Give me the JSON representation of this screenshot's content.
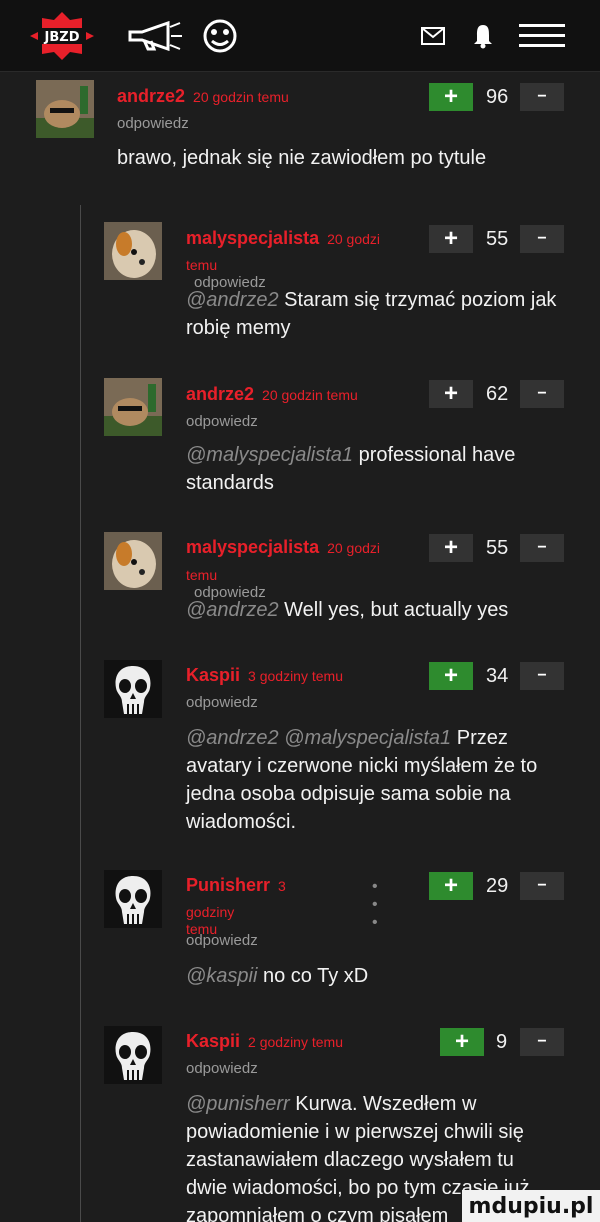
{
  "header": {
    "logo_text": "JBZD"
  },
  "comments": [
    {
      "author": "andrze2",
      "time": "20 godzin temu",
      "reply_label": "odpowiedz",
      "score": "96",
      "plus_label": "+",
      "minus_label": "−",
      "text": "brawo, jednak się nie zawiodłem po tytule"
    },
    {
      "author": "malyspecjalista",
      "time": "20 godzi",
      "time_cont": "temu",
      "reply_label": "odpowiedz",
      "score": "55",
      "plus_label": "+",
      "minus_label": "−",
      "mention": "@andrze2",
      "text_line1": "Staram się trzymać poziom jak",
      "text_line2": "robię memy"
    },
    {
      "author": "andrze2",
      "time": "20 godzin temu",
      "reply_label": "odpowiedz",
      "score": "62",
      "plus_label": "+",
      "minus_label": "−",
      "mention": "@malyspecjalista1",
      "text_line1": "professional have",
      "text_line2": "standards"
    },
    {
      "author": "malyspecjalista",
      "time": "20 godzi",
      "time_cont": "temu",
      "reply_label": "odpowiedz",
      "score": "55",
      "plus_label": "+",
      "minus_label": "−",
      "mention": "@andrze2",
      "text": "Well yes, but actually yes"
    },
    {
      "author": "Kaspii",
      "time": "3 godziny temu",
      "reply_label": "odpowiedz",
      "score": "34",
      "plus_label": "+",
      "minus_label": "−",
      "mention": "@andrze2 @malyspecjalista1",
      "text_line1": "Przez",
      "text_line2": "avatary i czerwone nicki myślałem że to",
      "text_line3": "jedna osoba odpisuje sama sobie na",
      "text_line4": "wiadomości."
    },
    {
      "author": "Punisherr",
      "time": "3",
      "time_cont": "godziny temu",
      "reply_label": "odpowiedz",
      "score": "29",
      "dots": "• • •",
      "plus_label": "+",
      "minus_label": "−",
      "mention": "@kaspii",
      "text": "no co Ty xD"
    },
    {
      "author": "Kaspii",
      "time": "2 godziny temu",
      "reply_label": "odpowiedz",
      "score": "9",
      "plus_label": "+",
      "minus_label": "−",
      "mention": "@punisherr",
      "text_line1": "Kurwa. Wszedłem w",
      "text_line2": "powiadomienie i w pierwszej chwili się",
      "text_line3": "zastanawiałem dlaczego wysłałem tu",
      "text_line4": "dwie wiadomości, bo po tym czasie już",
      "text_line5": "zapomniałem o czym pisałem"
    }
  ],
  "watermark": "mdupiu.pl",
  "colors": {
    "background": "#1d1d1d",
    "author": "#e8202a",
    "plus_active": "#2e8b2e",
    "button": "#333333"
  }
}
